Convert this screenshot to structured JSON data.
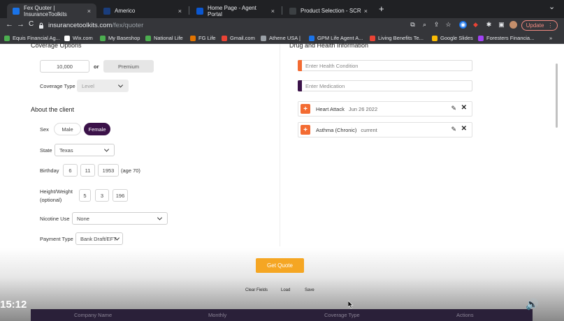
{
  "browser": {
    "tabs": [
      {
        "title": "Fex Quoter | InsuranceToolkits",
        "close": "×",
        "active": true,
        "favicon_color": "#1a73e8"
      },
      {
        "title": "Americo",
        "close": "×",
        "active": false,
        "favicon_color": "#1a3d7c"
      },
      {
        "title": "Home Page - Agent Portal",
        "close": "×",
        "active": false,
        "favicon_color": "#0b57d0"
      },
      {
        "title": "Product Selection - SCR",
        "close": "×",
        "active": false,
        "favicon_color": "#3c4043"
      }
    ],
    "new_tab": "+",
    "tab_menu": "⌄",
    "nav": {
      "back": "←",
      "forward": "→",
      "reload": "C"
    },
    "url_host": "insurancetoolkits.com",
    "url_path": "/fex/quoter",
    "update_label": "Update",
    "update_more": "⋮",
    "bookmarks": [
      {
        "label": "Equis Financial Ag...",
        "color": "#4caf50"
      },
      {
        "label": "Wix.com",
        "color": "#ffffff"
      },
      {
        "label": "My Baseshop",
        "color": "#4caf50"
      },
      {
        "label": "National Life",
        "color": "#4caf50"
      },
      {
        "label": "FG Life",
        "color": "#e37400"
      },
      {
        "label": "Gmail.com",
        "color": "#ea4335"
      },
      {
        "label": "Athene USA |",
        "color": "#9aa0a6"
      },
      {
        "label": "GPM Life Agent A...",
        "color": "#1a73e8"
      },
      {
        "label": "Living Benefits Te...",
        "color": "#ea4335"
      },
      {
        "label": "Google Slides",
        "color": "#fbbc04"
      },
      {
        "label": "Foresters Financia...",
        "color": "#a142f4"
      }
    ],
    "bookmarks_more": "»"
  },
  "left": {
    "coverage_options_title": "Coverage Options",
    "coverage_amount": "10,000",
    "or_label": "or",
    "premium_button": "Premium",
    "coverage_type_label": "Coverage Type",
    "coverage_type_value": "Level",
    "about_title": "About the client",
    "sex_label": "Sex",
    "male_label": "Male",
    "female_label": "Female",
    "state_label": "State",
    "state_value": "Texas",
    "birthday_label": "Birthday",
    "birth_month": "6",
    "birth_day": "11",
    "birth_year": "1953",
    "age_text": "(age 70)",
    "height_weight_label": "Height/Weight",
    "optional_label": "(optional)",
    "height_ft": "5",
    "height_in": "3",
    "weight": "196",
    "nicotine_label": "Nicotine Use",
    "nicotine_value": "None",
    "payment_label": "Payment Type",
    "payment_value": "Bank Draft/EFT"
  },
  "right": {
    "title": "Drug and Health Information",
    "health_placeholder": "Enter Health Condition",
    "medication_placeholder": "Enter Medication",
    "conditions": [
      {
        "name": "Heart Attack",
        "date": "Jun 26 2022"
      },
      {
        "name": "Asthma (Chronic)",
        "date": "current"
      }
    ],
    "plus_glyph": "+",
    "pencil_glyph": "✎",
    "close_glyph": "✕"
  },
  "actions": {
    "get_quote": "Get Quote",
    "clear_fields": "Clear Fields",
    "load": "Load",
    "save": "Save"
  },
  "results_table": {
    "headers": [
      "Company Name",
      "Monthly",
      "Coverage Type",
      "Actions"
    ]
  },
  "video": {
    "timestamp": "15:12",
    "volume_glyph": "🔊"
  },
  "colors": {
    "accent_purple": "#3b1249",
    "accent_orange": "#f36b32",
    "get_quote_bg": "#f5a623",
    "table_header_bg": "#2a2039"
  }
}
